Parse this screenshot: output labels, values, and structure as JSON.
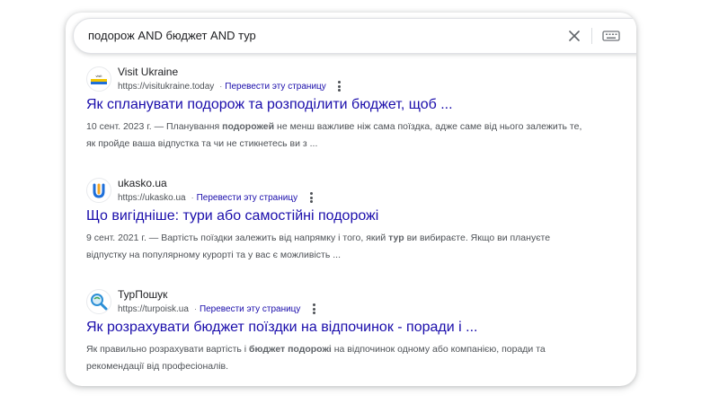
{
  "search": {
    "query": "подорож AND бюджет AND тур"
  },
  "results": [
    {
      "site_name": "Visit Ukraine",
      "url": "https://visitukraine.today",
      "translate": "Перевести эту страницу",
      "title": "Як спланувати подорож та розподілити бюджет, щоб ...",
      "snippet_date": "10 сент. 2023 г. —",
      "snippet_pre": " Планування ",
      "snippet_bold1": "подорожей",
      "snippet_post": " не менш важливе ніж сама поїздка, адже саме від нього залежить те, як пройде ваша відпустка та чи не стикнетесь ви з ...",
      "favicon_label": "VISIT UKRAINE"
    },
    {
      "site_name": "ukasko.ua",
      "url": "https://ukasko.ua",
      "translate": "Перевести эту страницу",
      "title": "Що вигідніше: тури або самостійні подорожі",
      "snippet_date": "9 сент. 2021 г. —",
      "snippet_pre": " Вартість поїздки залежить від напрямку і того, який ",
      "snippet_bold1": "тур",
      "snippet_post": " ви вибираєте. Якщо ви плануєте відпустку на популярному курорті та у вас є можливість ...",
      "favicon_label": "U"
    },
    {
      "site_name": "ТурПошук",
      "url": "https://turpoisk.ua",
      "translate": "Перевести эту страницу",
      "title": "Як розрахувати бюджет поїздки на відпочинок - поради і ...",
      "snippet_date": "",
      "snippet_pre": "Як правильно розрахувати вартість і ",
      "snippet_bold1": "бюджет подорожі",
      "snippet_post": " на відпочинок одному або компанією, поради та рекомендації від професіоналів.",
      "favicon_label": ""
    }
  ],
  "icons": {
    "clear": "close-icon",
    "keyboard": "keyboard-icon",
    "more": "more-vert-icon"
  },
  "colors": {
    "link": "#1a0dab",
    "text": "#202124",
    "snippet": "#4d5156"
  }
}
